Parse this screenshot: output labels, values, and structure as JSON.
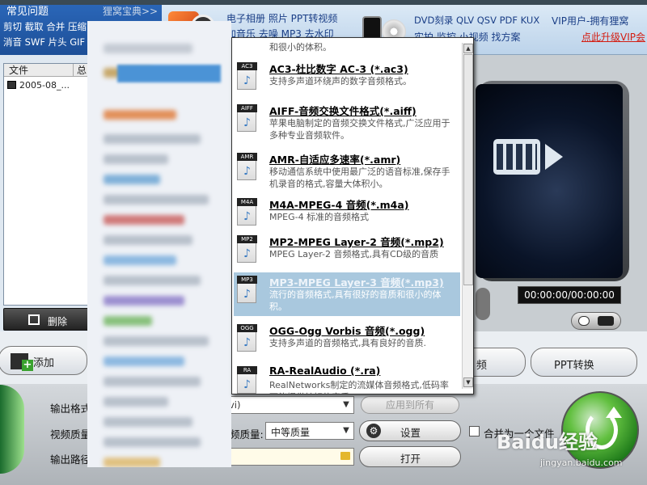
{
  "topbar": {
    "faq_title": "常见问题",
    "tips_title": "狸窝宝典>>",
    "faq_links_row1": "剪切 截取 合并 压缩 字幕 微信",
    "faq_links_row2": "消音 SWF 片头 GIF",
    "ad1_line1": "电子相册 照片 PPT转视频",
    "ad1_line2": "加音乐 去噪 MP3 去水印",
    "ad2_line1": "DVD刻录 QLV QSV PDF KUX",
    "ad2_line2": "实拍 监控 小视频 找方案",
    "vip_line1": "VIP用户-拥有狸窝",
    "vip_line2": "点此升级VIP会"
  },
  "file_list": {
    "col_file": "文件",
    "col_total": "总",
    "rows": [
      {
        "name": "2005-08_..."
      }
    ],
    "delete_label": "删除"
  },
  "format_list": {
    "items": [
      {
        "tag": "",
        "title": "",
        "desc": "和很小的体积。",
        "selected": false
      },
      {
        "tag": "AC3",
        "title": "AC3-杜比数字 AC-3 (*.ac3)",
        "desc": "支持多声道环绕声的数字音频格式。",
        "selected": false
      },
      {
        "tag": "AIFF",
        "title": "AIFF-音频交换文件格式(*.aiff)",
        "desc": "苹果电脑制定的音频交换文件格式,广泛应用于多种专业音频软件。",
        "selected": false
      },
      {
        "tag": "AMR",
        "title": "AMR-自适应多速率(*.amr)",
        "desc": "移动通信系统中使用最广泛的语音标准,保存手机录音的格式,容量大体积小。",
        "selected": false
      },
      {
        "tag": "M4A",
        "title": "M4A-MPEG-4 音频(*.m4a)",
        "desc": "MPEG-4 标准的音频格式",
        "selected": false
      },
      {
        "tag": "MP2",
        "title": "MP2-MPEG Layer-2 音频(*.mp2)",
        "desc": "MPEG Layer-2 音频格式,具有CD级的音质",
        "selected": false
      },
      {
        "tag": "MP3",
        "title": "MP3-MPEG Layer-3 音频(*.mp3)",
        "desc": "流行的音频格式,具有很好的音质和很小的体积。",
        "selected": true
      },
      {
        "tag": "OGG",
        "title": "OGG-Ogg Vorbis 音频(*.ogg)",
        "desc": "支持多声道的音频格式,具有良好的音质.",
        "selected": false
      },
      {
        "tag": "RA",
        "title": "RA-RealAudio (*.ra)",
        "desc": "RealNetworks制定的流媒体音频格式,低码率下能提供较好的音质。",
        "selected": false
      }
    ]
  },
  "preview": {
    "timecode": "00:00:00/00:00:00"
  },
  "toolbar": {
    "add_label": "添加",
    "video_label": "频",
    "ppt_label": "PPT转换"
  },
  "output": {
    "format_label": "输出格式",
    "format_value": "vi)",
    "quality_label": "视频质量",
    "audio_quality_label": "频质量:",
    "audio_quality_value": "中等质量",
    "path_label": "输出路径",
    "apply_all_label": "应用到所有",
    "settings_label": "设置",
    "open_label": "打开",
    "merge_label": "合并为一个文件"
  },
  "watermark": {
    "main": "Baidu经验",
    "url": "jingyan.baidu.com"
  },
  "colors": {
    "accent": "#1d4f97",
    "selection": "#a9c8de",
    "convert_green": "#62c040",
    "vip_red": "#d41d12"
  }
}
